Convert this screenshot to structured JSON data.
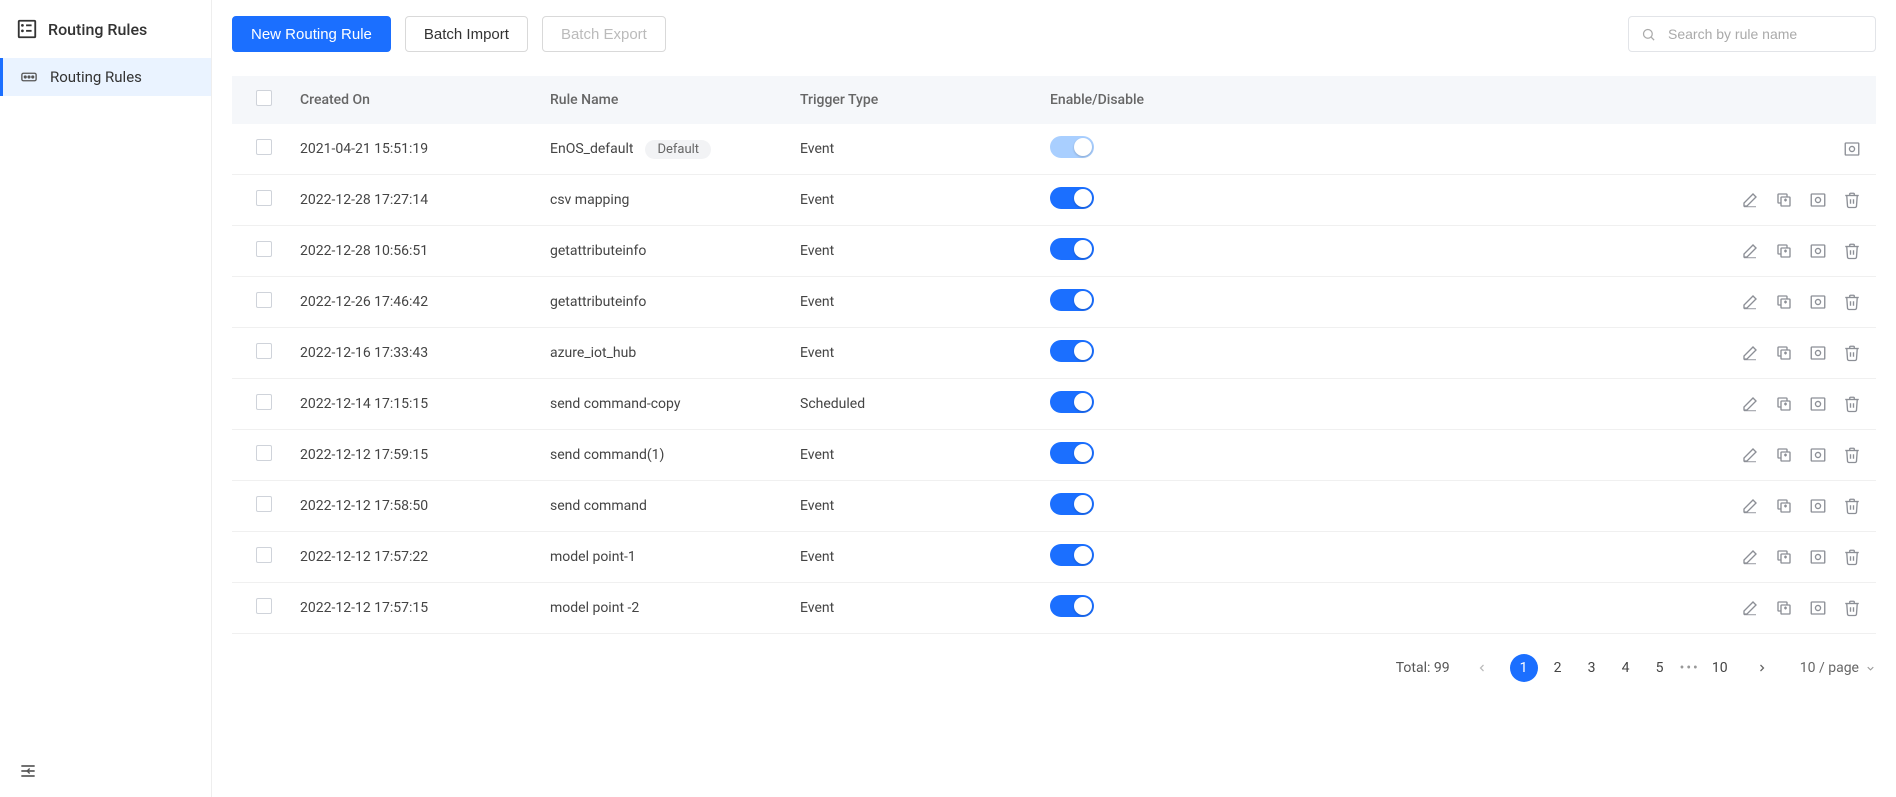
{
  "sidebar": {
    "title": "Routing Rules",
    "items": [
      {
        "label": "Routing Rules"
      }
    ]
  },
  "toolbar": {
    "new_label": "New Routing Rule",
    "import_label": "Batch Import",
    "export_label": "Batch Export"
  },
  "search": {
    "placeholder": "Search by rule name"
  },
  "table": {
    "headers": {
      "created": "Created On",
      "name": "Rule Name",
      "trigger": "Trigger Type",
      "enable": "Enable/Disable"
    },
    "default_badge": "Default",
    "rows": [
      {
        "created": "2021-04-21 15:51:19",
        "name": "EnOS_default",
        "trigger": "Event",
        "default": true,
        "enabled": true,
        "locked": true
      },
      {
        "created": "2022-12-28 17:27:14",
        "name": "csv mapping",
        "trigger": "Event",
        "default": false,
        "enabled": true,
        "locked": false
      },
      {
        "created": "2022-12-28 10:56:51",
        "name": "getattributeinfo",
        "trigger": "Event",
        "default": false,
        "enabled": true,
        "locked": false
      },
      {
        "created": "2022-12-26 17:46:42",
        "name": "getattributeinfo",
        "trigger": "Event",
        "default": false,
        "enabled": true,
        "locked": false
      },
      {
        "created": "2022-12-16 17:33:43",
        "name": "azure_iot_hub",
        "trigger": "Event",
        "default": false,
        "enabled": true,
        "locked": false
      },
      {
        "created": "2022-12-14 17:15:15",
        "name": "send command-copy",
        "trigger": "Scheduled",
        "default": false,
        "enabled": true,
        "locked": false
      },
      {
        "created": "2022-12-12 17:59:15",
        "name": "send command(1)",
        "trigger": "Event",
        "default": false,
        "enabled": true,
        "locked": false
      },
      {
        "created": "2022-12-12 17:58:50",
        "name": "send command",
        "trigger": "Event",
        "default": false,
        "enabled": true,
        "locked": false
      },
      {
        "created": "2022-12-12 17:57:22",
        "name": "model point-1",
        "trigger": "Event",
        "default": false,
        "enabled": true,
        "locked": false
      },
      {
        "created": "2022-12-12 17:57:15",
        "name": "model point -2",
        "trigger": "Event",
        "default": false,
        "enabled": true,
        "locked": false
      }
    ]
  },
  "pagination": {
    "total_label": "Total: 99",
    "pages": [
      "1",
      "2",
      "3",
      "4",
      "5"
    ],
    "last_page": "10",
    "page_size_label": "10 / page"
  }
}
